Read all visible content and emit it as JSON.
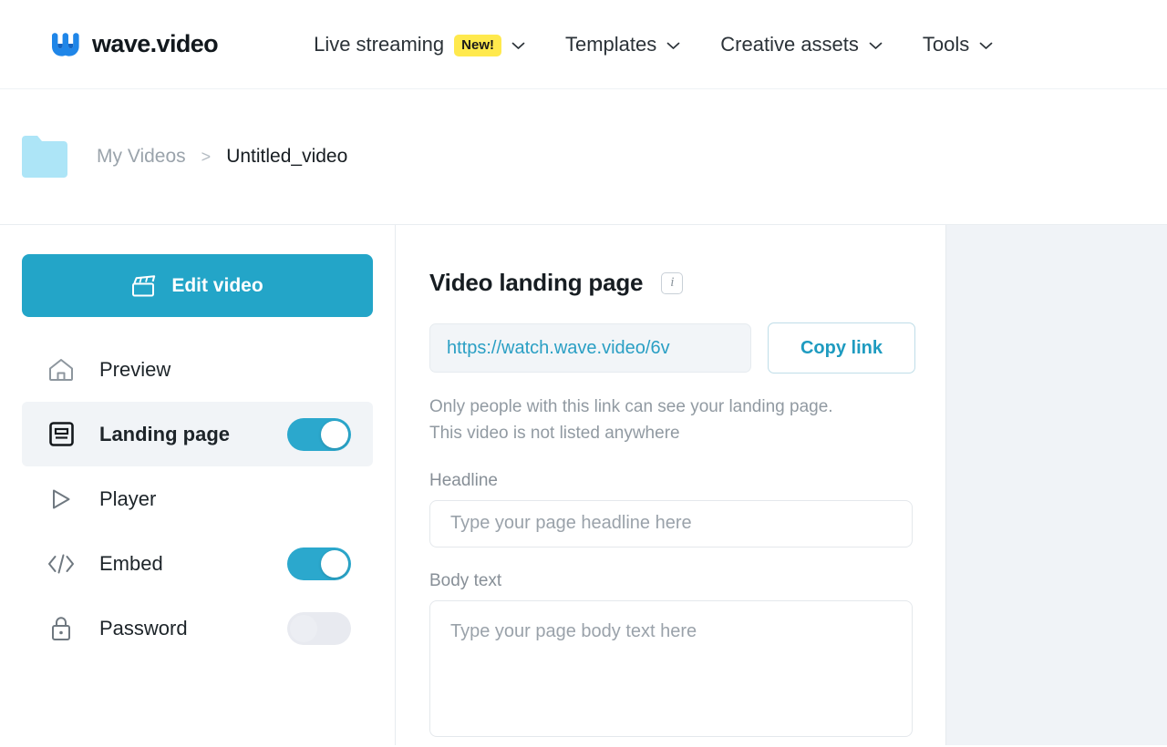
{
  "header": {
    "logo_text": "wave.video",
    "logo_icon": "wave-w-logo-icon",
    "nav": [
      {
        "label": "Live streaming",
        "badge": "New!",
        "has_chevron": true
      },
      {
        "label": "Templates",
        "badge": null,
        "has_chevron": true
      },
      {
        "label": "Creative assets",
        "badge": null,
        "has_chevron": true
      },
      {
        "label": "Tools",
        "badge": null,
        "has_chevron": true
      }
    ]
  },
  "breadcrumb": {
    "folder_icon": "folder-icon",
    "parent": "My Videos",
    "separator": ">",
    "current": "Untitled_video"
  },
  "sidebar": {
    "edit_button": {
      "label": "Edit video",
      "icon": "clapperboard-icon"
    },
    "items": [
      {
        "label": "Preview",
        "icon": "home-icon",
        "toggle": null,
        "active": false
      },
      {
        "label": "Landing page",
        "icon": "landing-page-icon",
        "toggle": "on",
        "active": true
      },
      {
        "label": "Player",
        "icon": "play-icon",
        "toggle": null,
        "active": false
      },
      {
        "label": "Embed",
        "icon": "code-icon",
        "toggle": "on",
        "active": false
      },
      {
        "label": "Password",
        "icon": "lock-icon",
        "toggle": "off",
        "active": false
      }
    ]
  },
  "main": {
    "title": "Video landing page",
    "info_icon": "info-icon",
    "url_value": "https://watch.wave.video/6v",
    "copy_button": "Copy link",
    "note_line1": "Only people with this link can see your landing page.",
    "note_line2": "This video is not listed anywhere",
    "headline_label": "Headline",
    "headline_placeholder": "Type your page headline here",
    "headline_value": "",
    "body_label": "Body text",
    "body_placeholder": "Type your page body text here",
    "body_value": ""
  },
  "colors": {
    "accent_teal": "#23a5c8",
    "badge_yellow": "#ffe94d",
    "folder_blue": "#ade5f7",
    "rail_bg": "#f0f3f7"
  }
}
